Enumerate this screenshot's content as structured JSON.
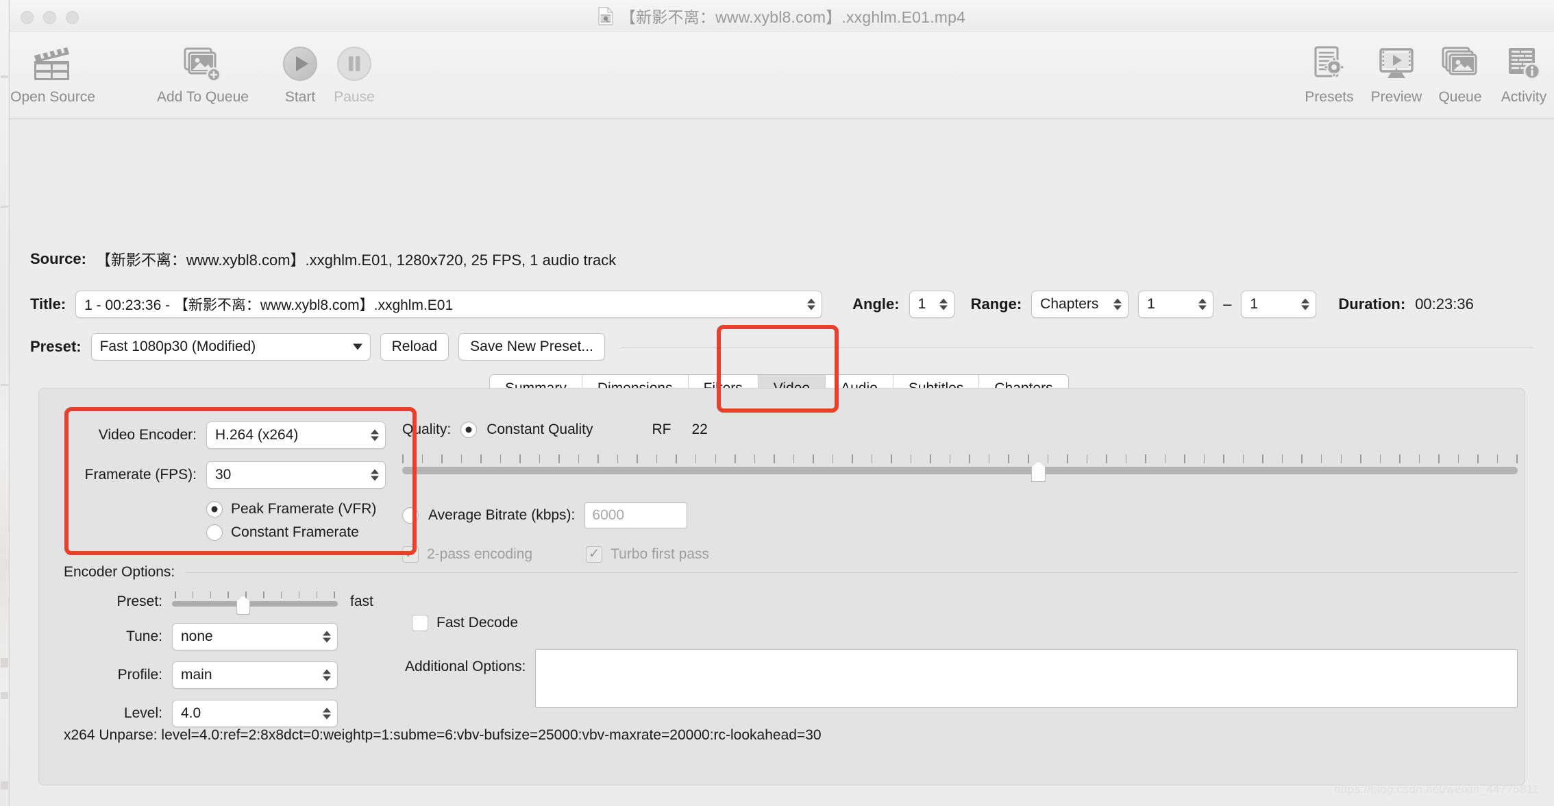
{
  "window": {
    "title": "【新影不离：www.xybl8.com】.xxghlm.E01.mp4",
    "title_icon": "document-video-icon"
  },
  "toolbar": {
    "left_items": [
      {
        "label": "Open Source",
        "icon": "clapperboard-icon",
        "enabled": true
      },
      {
        "label": "Add To Queue",
        "icon": "add-to-queue-icon",
        "enabled": true
      },
      {
        "label": "Start",
        "icon": "play-icon",
        "enabled": true
      },
      {
        "label": "Pause",
        "icon": "pause-icon",
        "enabled": false
      }
    ],
    "right_items": [
      {
        "label": "Presets",
        "icon": "presets-icon"
      },
      {
        "label": "Preview",
        "icon": "preview-monitor-icon"
      },
      {
        "label": "Queue",
        "icon": "queue-stack-icon"
      },
      {
        "label": "Activity",
        "icon": "activity-log-icon"
      }
    ]
  },
  "source": {
    "label": "Source:",
    "value": "【新影不离：www.xybl8.com】.xxghlm.E01, 1280x720, 25 FPS, 1 audio track"
  },
  "title_row": {
    "label": "Title:",
    "selected": "1 - 00:23:36 - 【新影不离：www.xybl8.com】.xxghlm.E01",
    "angle_label": "Angle:",
    "angle_value": "1",
    "range_label": "Range:",
    "range_kind": "Chapters",
    "range_from": "1",
    "range_dash": "–",
    "range_to": "1",
    "duration_label": "Duration:",
    "duration_value": "00:23:36"
  },
  "preset_row": {
    "label": "Preset:",
    "selected": "Fast 1080p30 (Modified)",
    "reload_label": "Reload",
    "save_label": "Save New Preset..."
  },
  "tabs": [
    {
      "label": "Summary",
      "active": false
    },
    {
      "label": "Dimensions",
      "active": false
    },
    {
      "label": "Filters",
      "active": false
    },
    {
      "label": "Video",
      "active": true
    },
    {
      "label": "Audio",
      "active": false
    },
    {
      "label": "Subtitles",
      "active": false
    },
    {
      "label": "Chapters",
      "active": false
    }
  ],
  "video_tab": {
    "encoder_label": "Video Encoder:",
    "encoder_value": "H.264 (x264)",
    "framerate_label": "Framerate (FPS):",
    "framerate_value": "30",
    "framerate_modes": [
      {
        "label": "Peak Framerate (VFR)",
        "selected": true
      },
      {
        "label": "Constant Framerate",
        "selected": false
      }
    ],
    "quality_label": "Quality:",
    "constant_quality_label": "Constant Quality",
    "constant_quality_selected": true,
    "rf_label": "RF",
    "rf_value": "22",
    "rf_slider_percent": 57,
    "rf_tick_count": 58,
    "avg_bitrate_label": "Average Bitrate (kbps):",
    "avg_bitrate_selected": false,
    "avg_bitrate_placeholder": "6000",
    "two_pass_label": "2-pass encoding",
    "two_pass_checked": true,
    "two_pass_enabled": false,
    "turbo_label": "Turbo first pass",
    "turbo_checked": true,
    "turbo_enabled": false
  },
  "encoder_options": {
    "section_label": "Encoder Options:",
    "preset_label": "Preset:",
    "preset_value": "fast",
    "preset_slider_percent": 43,
    "preset_tick_count": 10,
    "tune_label": "Tune:",
    "tune_value": "none",
    "profile_label": "Profile:",
    "profile_value": "main",
    "level_label": "Level:",
    "level_value": "4.0",
    "fast_decode_label": "Fast Decode",
    "fast_decode_checked": false,
    "additional_options_label": "Additional Options:",
    "additional_options_value": ""
  },
  "unparse": "x264 Unparse: level=4.0:ref=2:8x8dct=0:weightp=1:subme=6:vbv-bufsize=25000:vbv-maxrate=20000:rc-lookahead=30",
  "annotations": {
    "color": "#e8412a",
    "boxes": [
      "video-tab-highlight",
      "encoder-framerate-highlight"
    ]
  },
  "watermark": "https://blog.csdn.net/weixin_44775811"
}
